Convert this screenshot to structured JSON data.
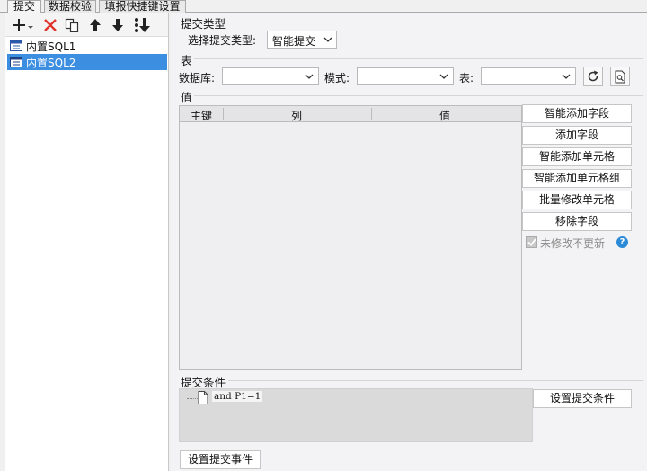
{
  "tabs": [
    {
      "label": "提交",
      "active": true
    },
    {
      "label": "数据校验",
      "active": false
    },
    {
      "label": "填报快捷键设置",
      "active": false
    }
  ],
  "toolbar": {
    "icons": [
      "add-icon",
      "delete-icon",
      "copy-icon",
      "move-up-icon",
      "move-down-icon",
      "sort-icon"
    ],
    "colors": {
      "add": "#222222",
      "delete": "#e0342b",
      "arrow": "#222222"
    }
  },
  "list": {
    "items": [
      {
        "label": "内置SQL1",
        "selected": false
      },
      {
        "label": "内置SQL2",
        "selected": true
      }
    ]
  },
  "submit_type": {
    "section": "提交类型",
    "label": "选择提交类型:",
    "value": "智能提交"
  },
  "table_section": {
    "section": "表",
    "db_label": "数据库:",
    "db_value": "",
    "mode_label": "模式:",
    "mode_value": "",
    "table_label": "表:",
    "table_value": ""
  },
  "values_section": {
    "section": "值",
    "columns": [
      "主键",
      "列",
      "值"
    ],
    "rows": []
  },
  "buttons": {
    "smart_add_field": "智能添加字段",
    "add_field": "添加字段",
    "smart_add_cell": "智能添加单元格",
    "smart_add_cell_group": "智能添加单元格组",
    "batch_modify_cell": "批量修改单元格",
    "remove_field": "移除字段",
    "no_update_label": "未修改不更新",
    "set_condition": "设置提交条件",
    "set_event": "设置提交事件"
  },
  "condition": {
    "section": "提交条件",
    "text": "and P1=1"
  },
  "accent": "#3c8ee0"
}
